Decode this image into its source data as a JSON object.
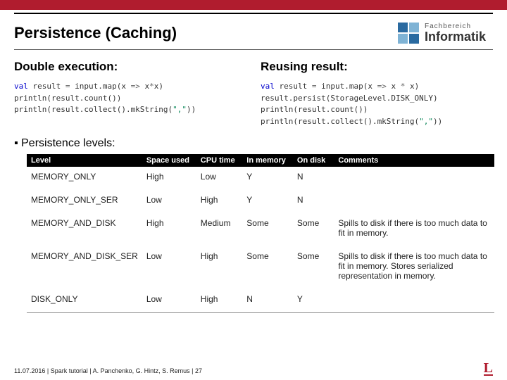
{
  "header": {
    "title": "Persistence (Caching)",
    "logo_line1": "Fachbereich",
    "logo_line2": "Informatik"
  },
  "left": {
    "heading": "Double execution:",
    "code": {
      "l1a": "val",
      "l1b": " result ",
      "l1c": "=",
      "l1d": " input.map(x ",
      "l1e": "=>",
      "l1f": " x",
      "l1g": "*",
      "l1h": "x)",
      "l2a": "println(result.count())",
      "l3a": "println(result.collect().mkString(",
      "l3b": "\",\"",
      "l3c": "))"
    }
  },
  "right": {
    "heading": "Reusing result:",
    "code": {
      "l1a": "val",
      "l1b": " result ",
      "l1c": "=",
      "l1d": " input.map(x ",
      "l1e": "=>",
      "l1f": " x ",
      "l1g": "*",
      "l1h": " x)",
      "l2a": "result.persist(StorageLevel.DISK_ONLY)",
      "l3a": "println(result.count())",
      "l4a": "println(result.collect().mkString(",
      "l4b": "\",\"",
      "l4c": "))"
    }
  },
  "persist_label": "Persistence levels:",
  "table": {
    "headers": [
      "Level",
      "Space used",
      "CPU time",
      "In memory",
      "On disk",
      "Comments"
    ],
    "rows": [
      [
        "MEMORY_ONLY",
        "High",
        "Low",
        "Y",
        "N",
        ""
      ],
      [
        "MEMORY_ONLY_SER",
        "Low",
        "High",
        "Y",
        "N",
        ""
      ],
      [
        "MEMORY_AND_DISK",
        "High",
        "Medium",
        "Some",
        "Some",
        "Spills to disk if there is too much data to fit in memory."
      ],
      [
        "MEMORY_AND_DISK_SER",
        "Low",
        "High",
        "Some",
        "Some",
        "Spills to disk if there is too much data to fit in memory. Stores serialized representation in memory."
      ],
      [
        "DISK_ONLY",
        "Low",
        "High",
        "N",
        "Y",
        ""
      ]
    ]
  },
  "footer": {
    "text": "11.07.2016  |  Spark tutorial |   A. Panchenko, G. Hintz, S. Remus   |  27",
    "logo": "L"
  }
}
